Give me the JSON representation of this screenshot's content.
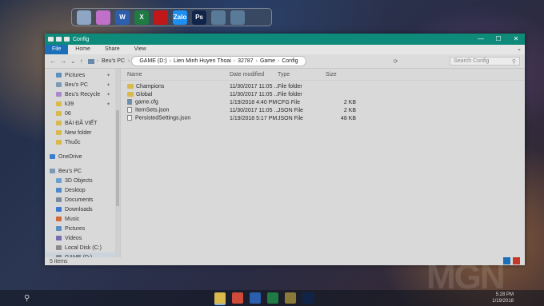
{
  "dock": {
    "icons": [
      {
        "name": "computer-icon",
        "color": "#8ca6c4",
        "glyph": ""
      },
      {
        "name": "recycle-bin-icon",
        "color": "#c070c8",
        "glyph": ""
      },
      {
        "name": "word-icon",
        "color": "#2b5fae",
        "glyph": "W"
      },
      {
        "name": "excel-icon",
        "color": "#1f7a43",
        "glyph": "X"
      },
      {
        "name": "game-client-icon",
        "color": "#c01818",
        "glyph": ""
      },
      {
        "name": "zalo-icon",
        "color": "#1e8ef0",
        "glyph": "Zalo"
      },
      {
        "name": "photoshop-icon",
        "color": "#10244a",
        "glyph": "Ps"
      },
      {
        "name": "document-icon",
        "color": "#5a7a9a",
        "glyph": ""
      },
      {
        "name": "document-icon-2",
        "color": "#5a7a9a",
        "glyph": ""
      }
    ]
  },
  "window": {
    "title": "Config",
    "controls": {
      "minimize": "—",
      "maximize": "☐",
      "close": "✕"
    },
    "ribbon_tabs": [
      "File",
      "Home",
      "Share",
      "View"
    ],
    "address": {
      "root": "Beu's PC",
      "path": [
        "GAME (D:)",
        "Lien Minh Huyen Thoai",
        "32787",
        "Game",
        "Config"
      ]
    },
    "search_placeholder": "Search Config",
    "nav_items": [
      {
        "label": "Pictures",
        "pinned": true,
        "color": "#5a8fc0",
        "level": "l2"
      },
      {
        "label": "Beu's PC",
        "pinned": true,
        "color": "#7a9ab8",
        "level": "l2"
      },
      {
        "label": "Beu's Recycle",
        "pinned": true,
        "color": "#aa88cc",
        "level": "l2"
      },
      {
        "label": "k39",
        "pinned": true,
        "color": "#d9b84c",
        "level": "l2"
      },
      {
        "label": "06",
        "pinned": false,
        "color": "#d9b84c",
        "level": "l2"
      },
      {
        "label": "BÀI ĐÃ VIẾT",
        "pinned": false,
        "color": "#d9b84c",
        "level": "l2"
      },
      {
        "label": "New folder",
        "pinned": false,
        "color": "#d9b84c",
        "level": "l2"
      },
      {
        "label": "Thuốc",
        "pinned": false,
        "color": "#d9b84c",
        "level": "l2"
      },
      {
        "gap": true
      },
      {
        "label": "OneDrive",
        "pinned": false,
        "color": "#3a7fd0",
        "level": "l1"
      },
      {
        "gap": true
      },
      {
        "label": "Beu's PC",
        "pinned": false,
        "color": "#7a9ab8",
        "level": "l1"
      },
      {
        "label": "3D Objects",
        "pinned": false,
        "color": "#6aa0d0",
        "level": "l2"
      },
      {
        "label": "Desktop",
        "pinned": false,
        "color": "#4a8ac8",
        "level": "l2"
      },
      {
        "label": "Documents",
        "pinned": false,
        "color": "#7a8a9a",
        "level": "l2"
      },
      {
        "label": "Downloads",
        "pinned": false,
        "color": "#3a7ad0",
        "level": "l2"
      },
      {
        "label": "Music",
        "pinned": false,
        "color": "#d06a3a",
        "level": "l2"
      },
      {
        "label": "Pictures",
        "pinned": false,
        "color": "#5a8fc0",
        "level": "l2"
      },
      {
        "label": "Videos",
        "pinned": false,
        "color": "#7a6ab0",
        "level": "l2"
      },
      {
        "label": "Local Disk (C:)",
        "pinned": false,
        "color": "#8a8a8a",
        "level": "l2"
      },
      {
        "label": "GAME (D:)",
        "pinned": false,
        "color": "#8a8a8a",
        "level": "l2",
        "selected": true
      }
    ],
    "columns": {
      "name": "Name",
      "date": "Date modified",
      "type": "Type",
      "size": "Size"
    },
    "files": [
      {
        "name": "Champions",
        "date": "11/30/2017 11:05 ...",
        "type": "File folder",
        "size": "",
        "kind": "folder"
      },
      {
        "name": "Global",
        "date": "11/30/2017 11:05 ...",
        "type": "File folder",
        "size": "",
        "kind": "folder"
      },
      {
        "name": "game.cfg",
        "date": "1/19/2018 4:40 PM",
        "type": "CFG File",
        "size": "2 KB",
        "kind": "cfg"
      },
      {
        "name": "ItemSets.json",
        "date": "11/30/2017 11:05 ...",
        "type": "JSON File",
        "size": "2 KB",
        "kind": "file"
      },
      {
        "name": "PersistedSettings.json",
        "date": "1/19/2018 5:17 PM",
        "type": "JSON File",
        "size": "48 KB",
        "kind": "file"
      }
    ],
    "status": "5 items"
  },
  "taskbar": {
    "search_glyph": "⚲",
    "apps": [
      {
        "name": "file-explorer-icon",
        "color": "#d9b84c",
        "active": true
      },
      {
        "name": "chrome-icon",
        "color": "#d04a3a",
        "active": false
      },
      {
        "name": "word-icon",
        "color": "#2b5fae",
        "active": false
      },
      {
        "name": "excel-icon",
        "color": "#1f7a43",
        "active": false
      },
      {
        "name": "game-icon",
        "color": "#8a7a3a",
        "active": false
      },
      {
        "name": "photoshop-icon",
        "color": "#10244a",
        "active": false
      }
    ],
    "time": "5:28 PM",
    "date": "1/19/2018"
  },
  "watermark": "MGN"
}
